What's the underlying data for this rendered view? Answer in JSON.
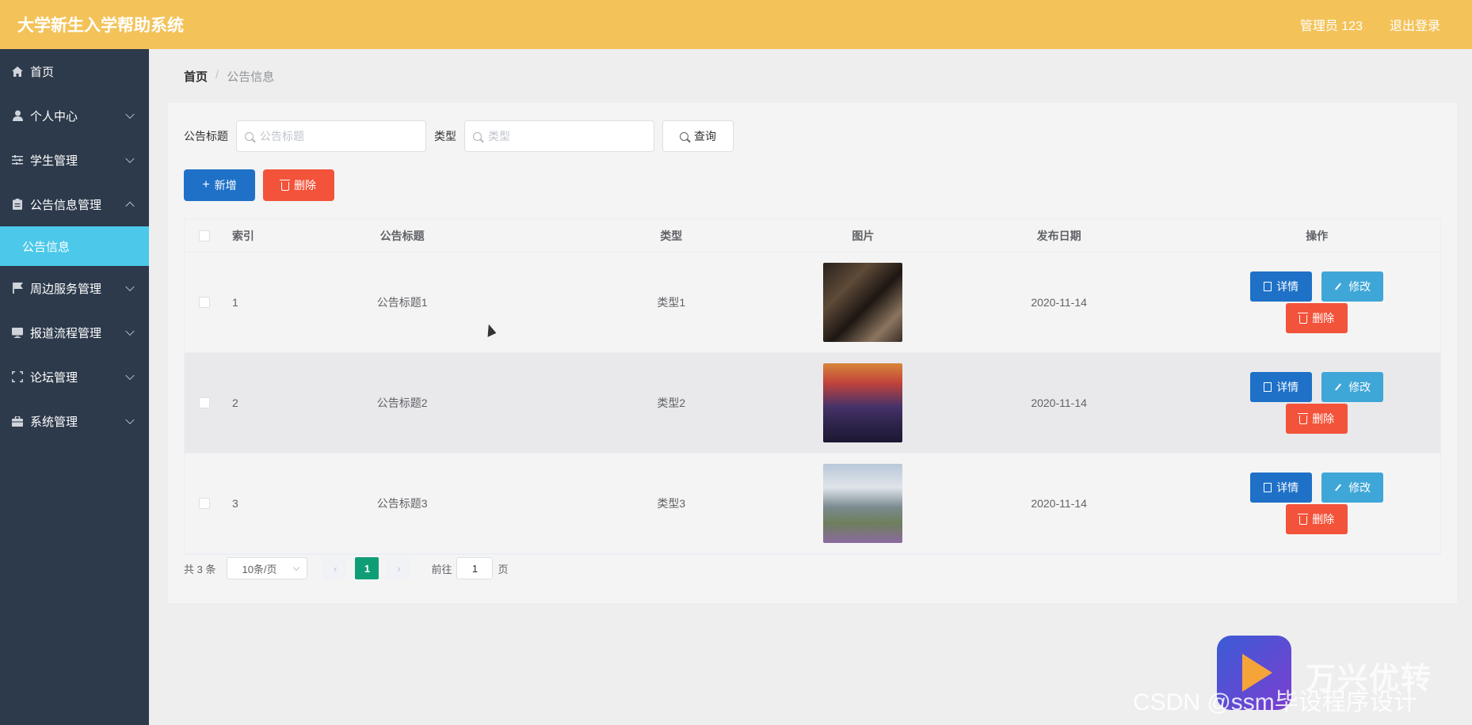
{
  "header": {
    "title": "大学新生入学帮助系统",
    "user_label": "管理员 123",
    "logout_label": "退出登录"
  },
  "sidebar": {
    "items": [
      {
        "label": "首页",
        "icon": "home-icon"
      },
      {
        "label": "个人中心",
        "icon": "user-icon"
      },
      {
        "label": "学生管理",
        "icon": "sliders-icon"
      },
      {
        "label": "公告信息管理",
        "icon": "clipboard-icon",
        "expanded": true
      },
      {
        "label": "公告信息",
        "submenu": true,
        "active": true
      },
      {
        "label": "周边服务管理",
        "icon": "flag-icon"
      },
      {
        "label": "报道流程管理",
        "icon": "monitor-icon"
      },
      {
        "label": "论坛管理",
        "icon": "frame-icon"
      },
      {
        "label": "系统管理",
        "icon": "briefcase-icon"
      }
    ]
  },
  "breadcrumb": {
    "home": "首页",
    "separator": "/",
    "current": "公告信息"
  },
  "search": {
    "title_label": "公告标题",
    "title_placeholder": "公告标题",
    "type_label": "类型",
    "type_placeholder": "类型",
    "query_label": "查询"
  },
  "actions": {
    "add_label": "新增",
    "delete_label": "删除"
  },
  "table": {
    "columns": [
      "索引",
      "公告标题",
      "类型",
      "图片",
      "发布日期",
      "操作"
    ],
    "rows": [
      {
        "index": "1",
        "title": "公告标题1",
        "type": "类型1",
        "date": "2020-11-14",
        "image": "dorm-room-photo"
      },
      {
        "index": "2",
        "title": "公告标题2",
        "type": "类型2",
        "date": "2020-11-14",
        "image": "auditorium-photo"
      },
      {
        "index": "3",
        "title": "公告标题3",
        "type": "类型3",
        "date": "2020-11-14",
        "image": "campus-building-photo"
      }
    ],
    "row_actions": {
      "detail": "详情",
      "edit": "修改",
      "delete": "删除"
    }
  },
  "pagination": {
    "total": "共 3 条",
    "page_size": "10条/页",
    "current_page": "1",
    "goto_label": "前往",
    "goto_value": "1",
    "page_suffix": "页"
  },
  "watermark": {
    "brand": "万兴优转",
    "csdn": "CSDN @ssm毕设程序设计"
  },
  "colors": {
    "header": "#f3c35a",
    "sidebar": "#2d3a4b",
    "active_submenu": "#4bc8ea",
    "primary": "#1e71c7",
    "danger": "#f2533a",
    "info": "#3fa6d8",
    "page_active": "#0f9d76"
  }
}
